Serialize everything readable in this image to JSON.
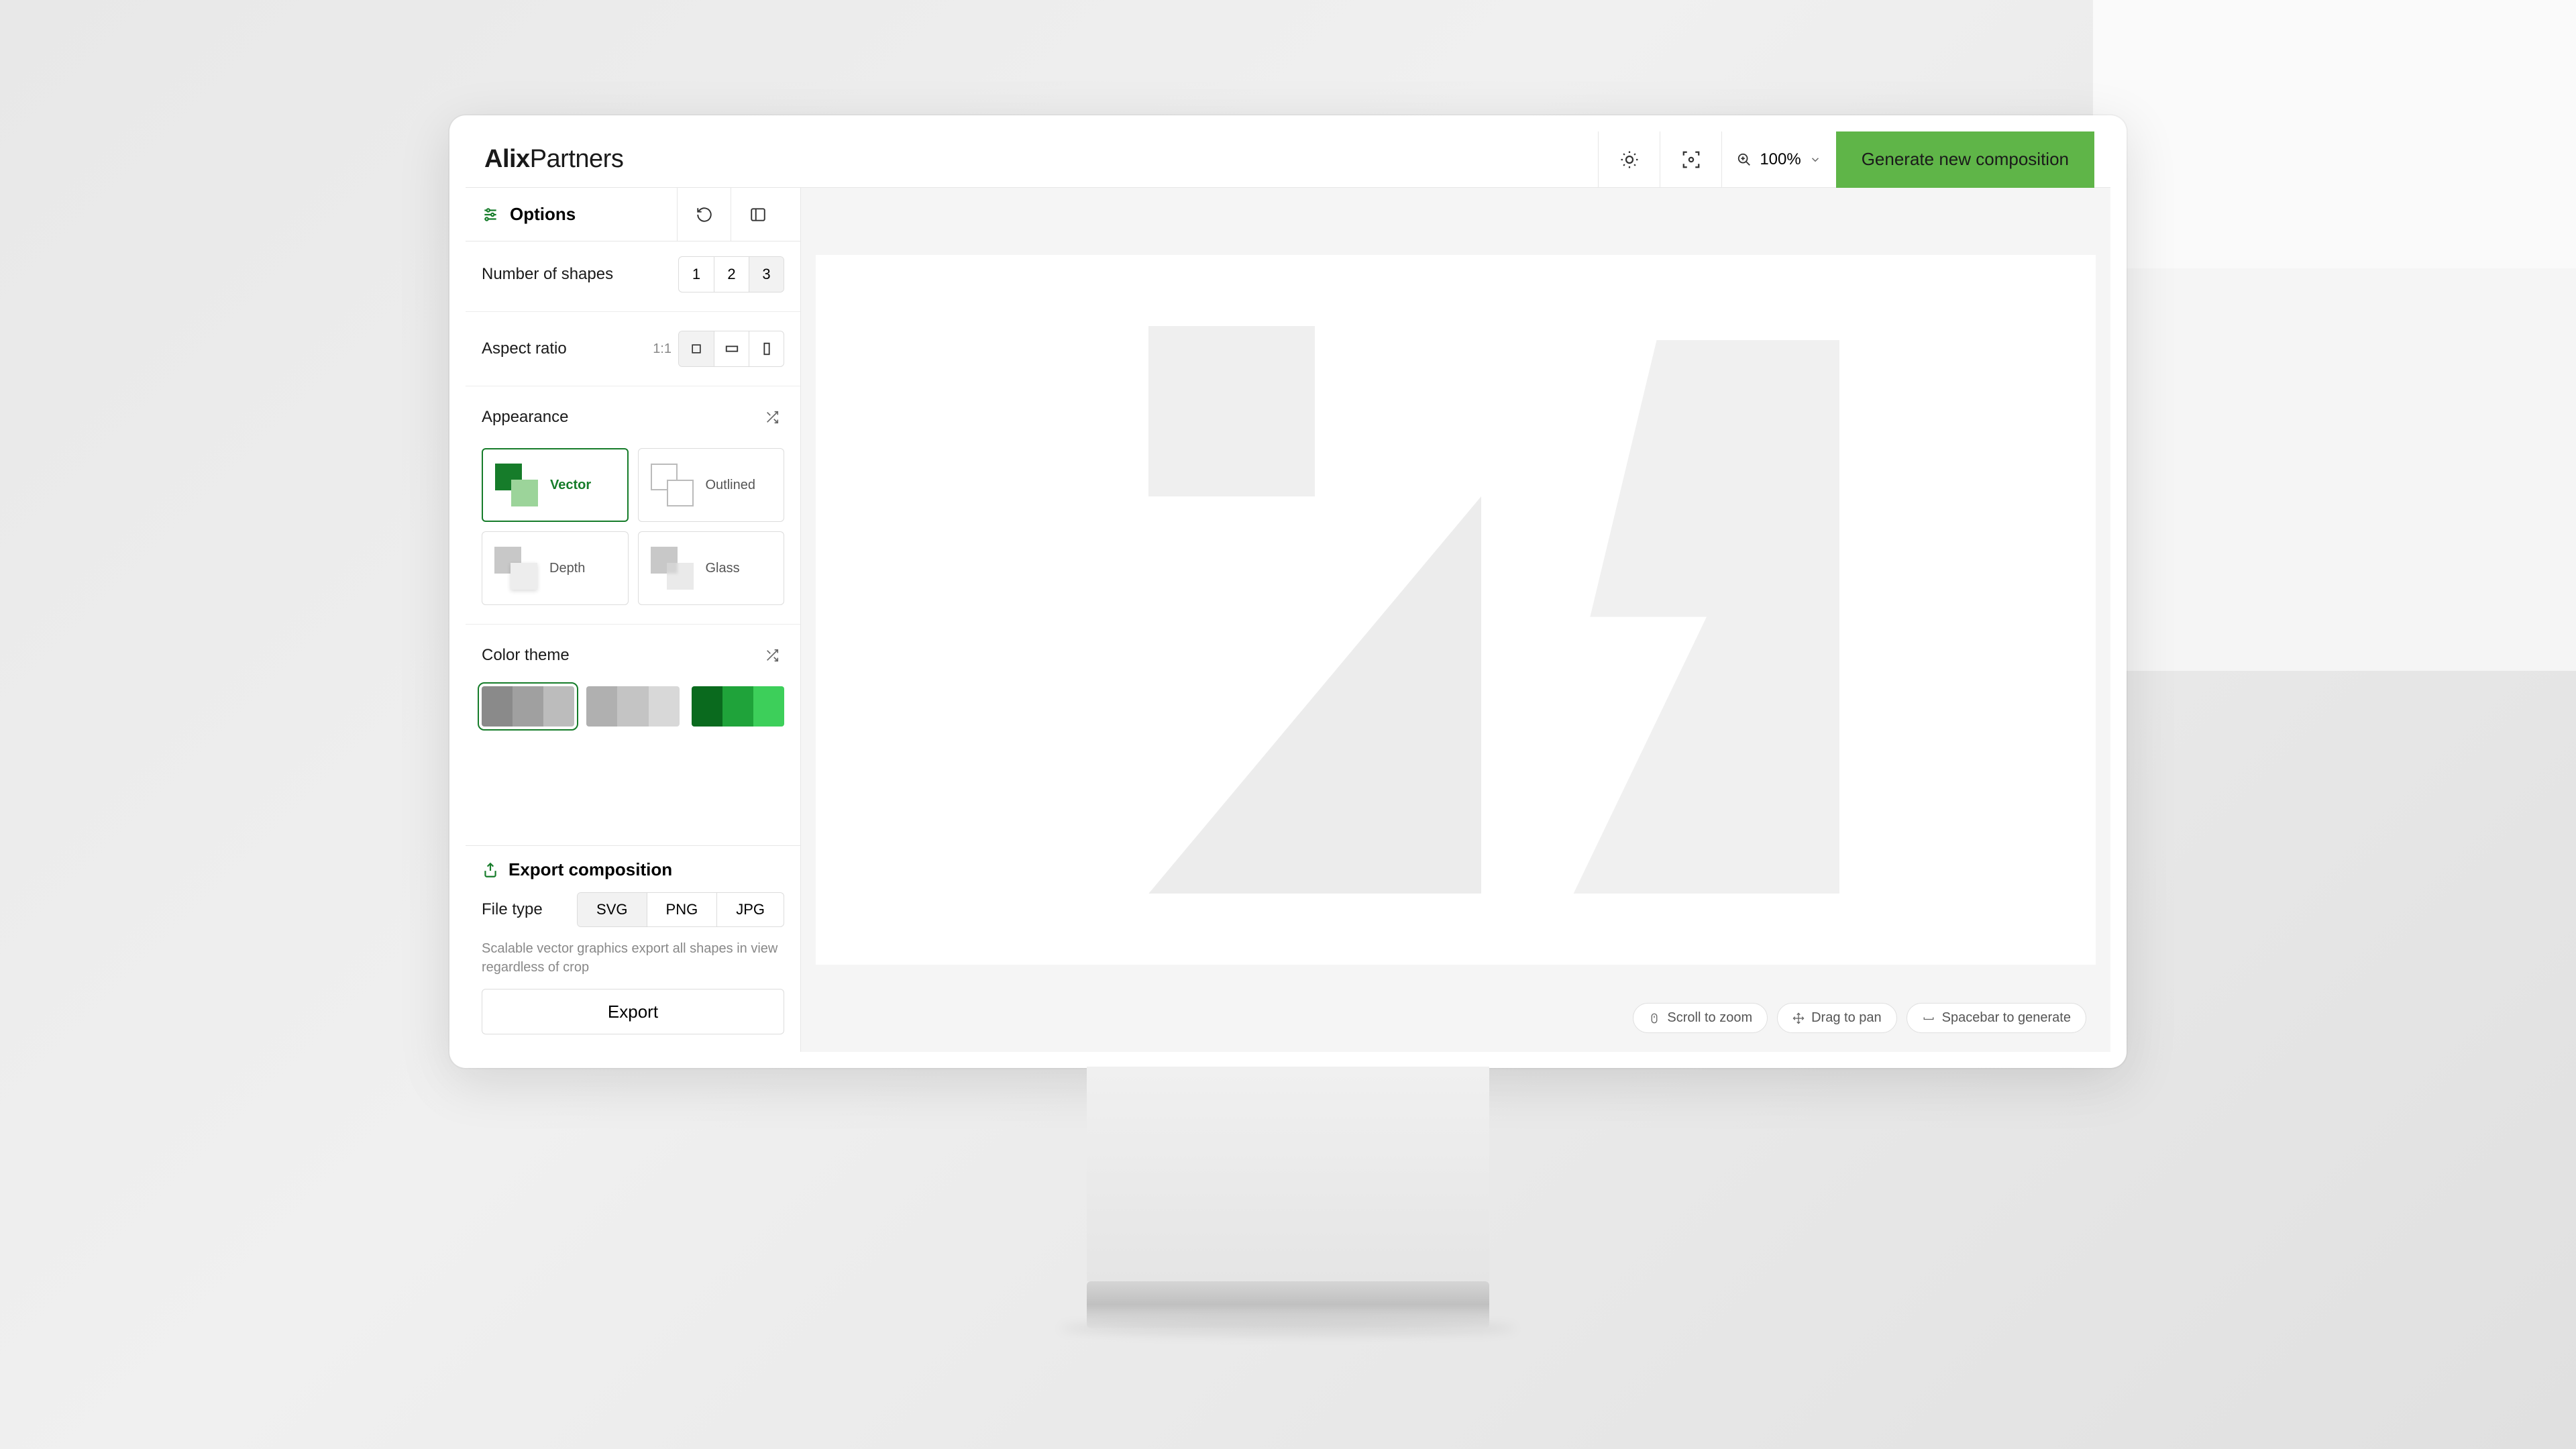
{
  "brand": {
    "bold": "Alix",
    "rest": "Partners"
  },
  "topbar": {
    "zoom_level": "100%",
    "generate_label": "Generate new composition"
  },
  "sidebar": {
    "title": "Options",
    "shapes": {
      "label": "Number of shapes",
      "options": [
        "1",
        "2",
        "3"
      ],
      "selected": "3"
    },
    "aspect": {
      "label": "Aspect ratio",
      "hint": "1:1",
      "selected": 0
    },
    "appearance": {
      "label": "Appearance",
      "options": [
        "Vector",
        "Outlined",
        "Depth",
        "Glass"
      ],
      "selected": "Vector"
    },
    "color_theme": {
      "label": "Color theme",
      "themes": [
        [
          "#8a8a8a",
          "#a0a0a0",
          "#bcbcbc"
        ],
        [
          "#b0b0b0",
          "#c4c4c4",
          "#d8d8d8"
        ],
        [
          "#0a6a1e",
          "#1fa33a",
          "#3dcf5a"
        ]
      ],
      "selected": 0
    }
  },
  "export": {
    "title": "Export composition",
    "file_type_label": "File type",
    "file_types": [
      "SVG",
      "PNG",
      "JPG"
    ],
    "selected_file_type": "SVG",
    "description": "Scalable vector graphics export all shapes in view regardless of crop",
    "button_label": "Export"
  },
  "hints": {
    "scroll": "Scroll to zoom",
    "drag": "Drag to pan",
    "space": "Spacebar to generate"
  }
}
